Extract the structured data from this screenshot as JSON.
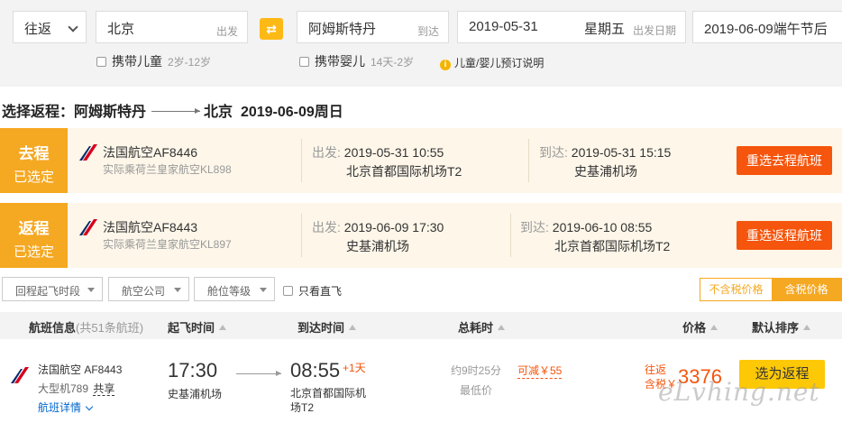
{
  "search": {
    "trip_type": "往返",
    "from_city": "北京",
    "from_tag": "出发",
    "swap_icon": "swap-arrows-icon",
    "to_city": "阿姆斯特丹",
    "to_tag": "到达",
    "depart_date": "2019-05-31",
    "depart_weekday": "星期五",
    "depart_tag": "出发日期",
    "return_date": "2019-06-09端午节后",
    "child_label": "携带儿童",
    "child_hint": "2岁-12岁",
    "infant_label": "携带婴儿",
    "infant_hint": "14天-2岁",
    "booking_note": "儿童/婴儿预订说明"
  },
  "title": {
    "prefix": "选择返程：",
    "from": "阿姆斯特丹",
    "to": "北京",
    "date": "2019-06-09周日"
  },
  "outbound": {
    "badge_title": "去程",
    "badge_status": "已选定",
    "airline": "法国航空AF8446",
    "operated_by": "实际乘荷兰皇家航空KL898",
    "depart_label": "出发:",
    "depart_time": "2019-05-31 10:55",
    "depart_airport": "北京首都国际机场T2",
    "arrive_label": "到达:",
    "arrive_time": "2019-05-31 15:15",
    "arrive_airport": "史基浦机场",
    "reselect": "重选去程航班"
  },
  "return": {
    "badge_title": "返程",
    "badge_status": "已选定",
    "airline": "法国航空AF8443",
    "operated_by": "实际乘荷兰皇家航空KL897",
    "depart_label": "出发:",
    "depart_time": "2019-06-09 17:30",
    "depart_airport": "史基浦机场",
    "arrive_label": "到达:",
    "arrive_time": "2019-06-10 08:55",
    "arrive_airport": "北京首都国际机场T2",
    "reselect": "重选返程航班"
  },
  "filters": {
    "time": "回程起飞时段",
    "airline": "航空公司",
    "cabin": "舱位等级",
    "direct_only": "只看直飞",
    "price_excl_tax": "不含税价格",
    "price_incl_tax": "含税价格"
  },
  "table_header": {
    "flight_info": "航班信息",
    "flight_count": "(共51条航班)",
    "depart_time": "起飞时间",
    "arrive_time": "到达时间",
    "duration": "总耗时",
    "price": "价格",
    "sort": "默认排序"
  },
  "result": {
    "airline": "法国航空 AF8443",
    "aircraft": "大型机789",
    "share": "共享",
    "detail": "航班详情",
    "depart_time": "17:30",
    "depart_airport": "史基浦机场",
    "arrive_time": "08:55",
    "plus_day": "+1天",
    "arrive_airport": "北京首都国际机场T2",
    "duration": "约9时25分",
    "lowest": "最低价",
    "discount": "可减￥55",
    "price_line1": "往返",
    "price_line2": "含税￥",
    "price": "3376",
    "choose": "选为返程"
  },
  "watermark": "eLvhing.net",
  "colors": {
    "badge": "#f5a822",
    "reselect_button": "#f5550c",
    "choose_button": "#fdc806",
    "price": "#f5550c",
    "swap": "#fdb915"
  }
}
